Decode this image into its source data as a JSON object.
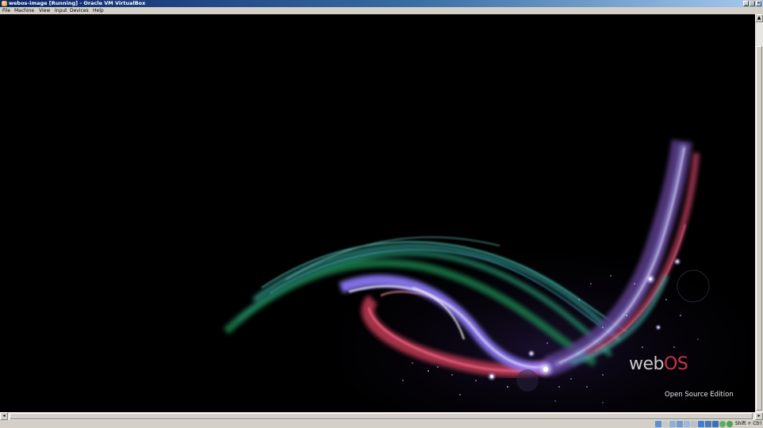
{
  "window": {
    "title": "webos-image [Running] - Oracle VM VirtualBox",
    "controls": {
      "minimize": "_",
      "maximize": "□",
      "close": "×"
    }
  },
  "menu": {
    "items": [
      "File",
      "Machine",
      "View",
      "Input",
      "Devices",
      "Help"
    ]
  },
  "guest": {
    "logo_web": "web",
    "logo_os": "OS",
    "subtitle": "Open Source Edition"
  },
  "statusbar": {
    "host_key": "Shift + Ctrl",
    "icons": [
      "hard-disk-icon",
      "optical-drive-icon",
      "audio-icon",
      "network-icon",
      "usb-icon",
      "shared-folders-icon",
      "display-icon",
      "video-capture-icon",
      "virtualization-icon",
      "mouse-integration-icon",
      "keyboard-icon"
    ]
  },
  "colors": {
    "title_active": "#0a246a",
    "chrome": "#d4d0c8",
    "logo_accent": "#c8344f"
  }
}
